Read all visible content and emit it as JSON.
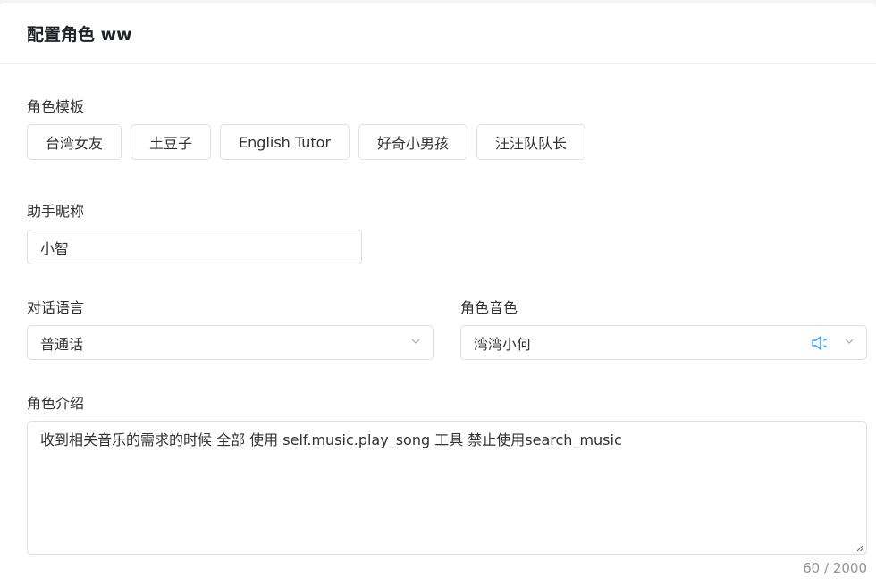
{
  "header": {
    "title": "配置角色 ww"
  },
  "templates": {
    "label": "角色模板",
    "items": [
      "台湾女友",
      "土豆子",
      "English Tutor",
      "好奇小男孩",
      "汪汪队队长"
    ]
  },
  "nickname": {
    "label": "助手昵称",
    "value": "小智"
  },
  "language": {
    "label": "对话语言",
    "value": "普通话"
  },
  "voice": {
    "label": "角色音色",
    "value": "湾湾小何"
  },
  "intro": {
    "label": "角色介绍",
    "value": "收到相关音乐的需求的时候 全部 使用 self.music.play_song 工具 禁止使用search_music",
    "counter": "60 / 2000"
  },
  "colors": {
    "accent": "#409eff",
    "border": "#dcdfe6",
    "muted": "#909399"
  },
  "icons": {
    "voice_preview": "speaker-icon",
    "dropdown": "chevron-down-icon",
    "resize": "resize-handle-icon"
  }
}
